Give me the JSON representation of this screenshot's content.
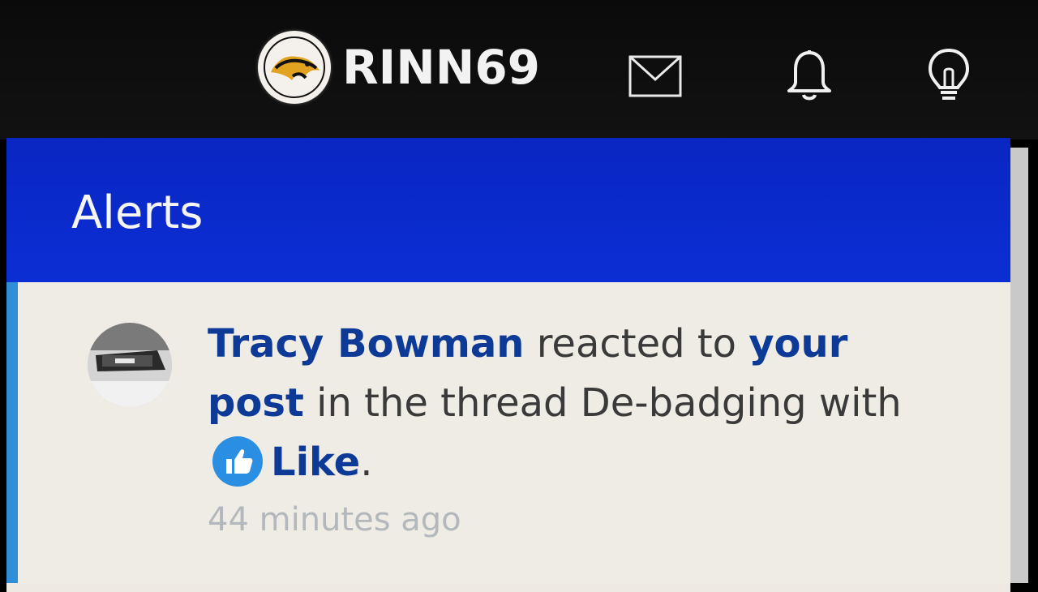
{
  "header": {
    "site_name": "RINN69",
    "icons": [
      "mail-icon",
      "bell-icon",
      "lightbulb-icon"
    ]
  },
  "panel": {
    "title": "Alerts"
  },
  "alert": {
    "actor": "Tracy Bowman",
    "action": " reacted to ",
    "target": "your post",
    "context": " in the thread De-badging with ",
    "reaction": "Like",
    "end": ".",
    "time": "44 minutes ago"
  },
  "colors": {
    "header_bg": "#0b2ed4",
    "link": "#0d3a96",
    "like": "#2a8fe2",
    "accent": "#2f8fd6"
  }
}
